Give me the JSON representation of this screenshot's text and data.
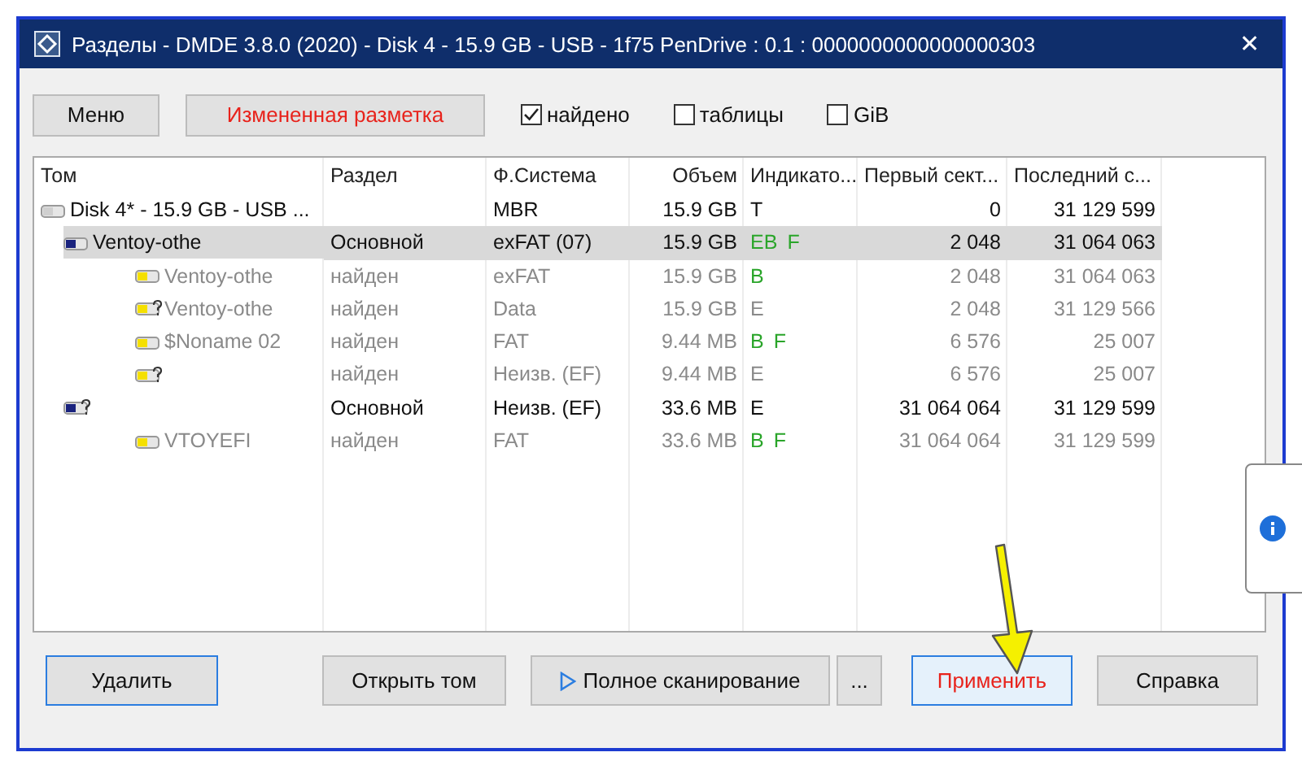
{
  "window": {
    "title": "Разделы - DMDE 3.8.0 (2020) - Disk 4 - 15.9 GB - USB - 1f75 PenDrive : 0.1 : 0000000000000000303",
    "close": "✕"
  },
  "toolbar": {
    "buttons": [
      {
        "label": "Меню",
        "alert": false
      },
      {
        "label": "Измененная разметка",
        "alert": true
      }
    ],
    "checkboxes": [
      {
        "label": "найдено",
        "checked": true
      },
      {
        "label": "таблицы",
        "checked": false
      },
      {
        "label": "GiB",
        "checked": false
      }
    ]
  },
  "table": {
    "columns": [
      "Том",
      "Раздел",
      "Ф.Система",
      "Объем",
      "Индикато...",
      "Первый сект...",
      "Последний с..."
    ],
    "rows": [
      {
        "kind": "disk",
        "name": "Disk 4* - 15.9 GB - USB ...",
        "fs": "MBR",
        "size": "15.9 GB",
        "flags": [
          {
            "text": "T",
            "highlighted": false
          }
        ],
        "first": "0",
        "last": "31 129 599",
        "muted": false,
        "selected": false,
        "children": [
          {
            "kind": "partition",
            "name": "Ventoy-othe",
            "partition": "Основной",
            "fs": "exFAT (07)",
            "size": "15.9 GB",
            "flags": [
              {
                "text": "EB",
                "highlighted": true
              },
              {
                "text": "F",
                "highlighted": true
              }
            ],
            "first": "2 048",
            "last": "31 064 063",
            "muted": false,
            "selected": true,
            "children": [
              {
                "kind": "found",
                "name": "Ventoy-othe",
                "partition": "найден",
                "fs": "exFAT",
                "size": "15.9 GB",
                "flags": [
                  {
                    "text": "B",
                    "highlighted": true
                  }
                ],
                "first": "2 048",
                "last": "31 064 063",
                "muted": true,
                "selected": false
              },
              {
                "kind": "unknown",
                "name": "Ventoy-othe",
                "partition": "найден",
                "fs": "Data",
                "size": "15.9 GB",
                "flags": [
                  {
                    "text": "E",
                    "highlighted": false
                  }
                ],
                "first": "2 048",
                "last": "31 129 566",
                "muted": true,
                "selected": false
              },
              {
                "kind": "found",
                "name": "$Noname 02",
                "partition": "найден",
                "fs": "FAT",
                "size": "9.44 MB",
                "flags": [
                  {
                    "text": "B",
                    "highlighted": true
                  },
                  {
                    "text": "F",
                    "highlighted": true
                  }
                ],
                "first": "6 576",
                "last": "25 007",
                "muted": true,
                "selected": false
              },
              {
                "kind": "unknown",
                "partition": "найден",
                "fs": "Неизв. (EF)",
                "size": "9.44 MB",
                "flags": [
                  {
                    "text": "E",
                    "highlighted": false
                  }
                ],
                "first": "6 576",
                "last": "25 007",
                "muted": true,
                "selected": false
              }
            ]
          },
          {
            "kind": "partition-unknown",
            "partition": "Основной",
            "fs": "Неизв. (EF)",
            "size": "33.6 MB",
            "flags": [
              {
                "text": "E",
                "highlighted": false
              }
            ],
            "first": "31 064 064",
            "last": "31 129 599",
            "muted": false,
            "selected": false,
            "children": [
              {
                "kind": "found",
                "name": "VTOYEFI",
                "partition": "найден",
                "fs": "FAT",
                "size": "33.6 MB",
                "flags": [
                  {
                    "text": "B",
                    "highlighted": true
                  },
                  {
                    "text": "F",
                    "highlighted": true
                  }
                ],
                "first": "31 064 064",
                "last": "31 129 599",
                "muted": true,
                "selected": false
              }
            ]
          }
        ]
      }
    ]
  },
  "actions": [
    {
      "label": "Удалить",
      "kind": "plain",
      "alert": false,
      "focused": true,
      "hovered": false
    },
    {
      "label": "Открыть том",
      "kind": "plain",
      "alert": false,
      "focused": false,
      "hovered": false
    },
    {
      "label": "Полное сканирование",
      "kind": "scan",
      "alert": false,
      "focused": false,
      "hovered": false
    },
    {
      "label": "...",
      "kind": "plain",
      "alert": false,
      "focused": false,
      "hovered": false
    },
    {
      "label": "Применить",
      "kind": "plain",
      "alert": true,
      "focused": true,
      "hovered": true
    },
    {
      "label": "Справка",
      "kind": "plain",
      "alert": false,
      "focused": false,
      "hovered": false
    }
  ]
}
